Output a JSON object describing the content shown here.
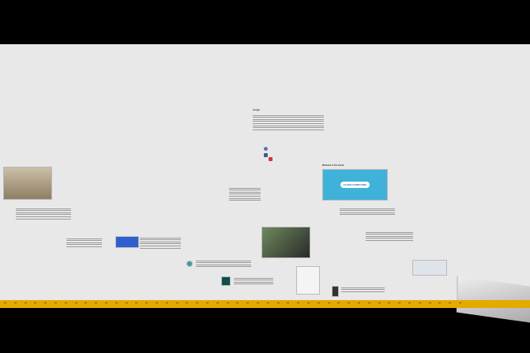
{
  "canvas": {
    "background": "#e8e8e8",
    "timeline_color": "#e5a900"
  },
  "entries": [
    {
      "title": "Google"
    },
    {
      "title": "Welcome to the Cloud"
    }
  ],
  "cloud_image": {
    "text": "CLOUD COMPUTING"
  }
}
